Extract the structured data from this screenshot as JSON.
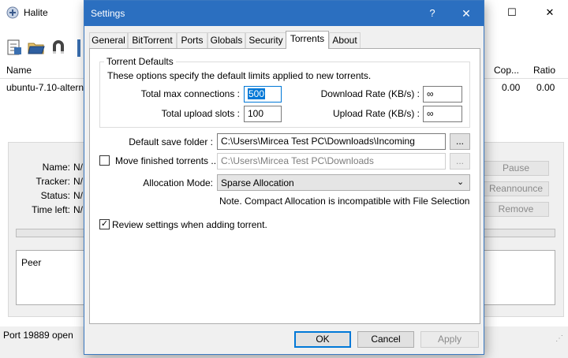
{
  "main_window": {
    "title": "Halite",
    "controls": {
      "minimize": "—",
      "maximize": "☐",
      "close": "✕"
    },
    "list_columns": [
      "Name",
      "Cop...",
      "Ratio"
    ],
    "list_rows": [
      {
        "name": "ubuntu-7.10-altern",
        "copies": "0.00",
        "ratio": "0.00"
      }
    ],
    "details": {
      "name_label": "Name:",
      "name_value": "N/",
      "tracker_label": "Tracker:",
      "tracker_value": "N/",
      "status_label": "Status:",
      "status_value": "N/",
      "time_left_label": "Time left:",
      "time_left_value": "N/"
    },
    "side_buttons": {
      "pause": "Pause",
      "reannounce": "Reannounce",
      "remove": "Remove"
    },
    "peer_label": "Peer",
    "status_bar": "Port 19889 open"
  },
  "settings_dialog": {
    "title": "Settings",
    "help_glyph": "?",
    "close_glyph": "✕",
    "tabs": [
      "General",
      "BitTorrent",
      "Ports",
      "Globals",
      "Security",
      "Torrents",
      "About"
    ],
    "active_tab": "Torrents",
    "torrent_defaults": {
      "legend": "Torrent Defaults",
      "description": "These options specify the default limits applied to new torrents.",
      "total_max_connections_label": "Total max connections :",
      "total_max_connections_value": "500",
      "total_upload_slots_label": "Total upload slots :",
      "total_upload_slots_value": "100",
      "download_rate_label": "Download Rate (KB/s) :",
      "download_rate_value": "∞",
      "upload_rate_label": "Upload Rate (KB/s) :",
      "upload_rate_value": "∞"
    },
    "default_save_folder_label": "Default save folder :",
    "default_save_folder_value": "C:\\Users\\Mircea Test PC\\Downloads\\Incoming",
    "browse_label": "...",
    "move_finished_label": "Move finished torrents ...",
    "move_finished_checked": false,
    "move_finished_value": "C:\\Users\\Mircea Test PC\\Downloads",
    "allocation_mode_label": "Allocation Mode:",
    "allocation_mode_value": "Sparse Allocation",
    "allocation_note": "Note. Compact Allocation is incompatible with File Selection",
    "review_settings_label": "Review settings when adding torrent.",
    "review_settings_checked": true,
    "ok_label": "OK",
    "cancel_label": "Cancel",
    "apply_label": "Apply"
  },
  "colors": {
    "accent": "#0078d7",
    "titlebar": "#2b6fc0",
    "dialog_bg": "#f0f0f0"
  }
}
